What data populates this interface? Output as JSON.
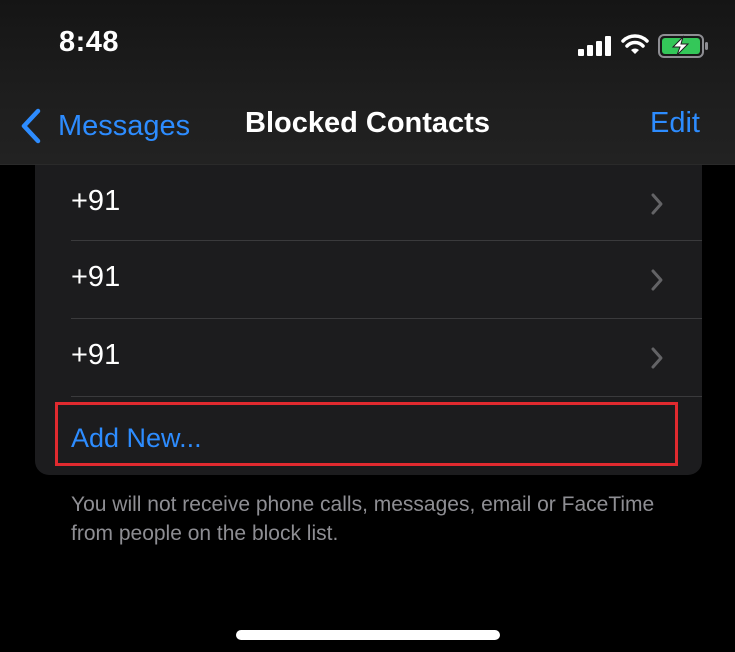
{
  "status_bar": {
    "time": "8:48"
  },
  "nav": {
    "back_label": "Messages",
    "title": "Blocked Contacts",
    "edit_label": "Edit"
  },
  "blocked_list": {
    "items": [
      {
        "number": "+91"
      },
      {
        "number": "+91"
      },
      {
        "number": "+91"
      }
    ],
    "add_new_label": "Add New..."
  },
  "footer": {
    "note": "You will not receive phone calls, messages, email or FaceTime from people on the block list."
  },
  "colors": {
    "accent": "#2d8cff",
    "background": "#000000",
    "card": "#1c1c1e",
    "highlight": "#e02a2f"
  }
}
